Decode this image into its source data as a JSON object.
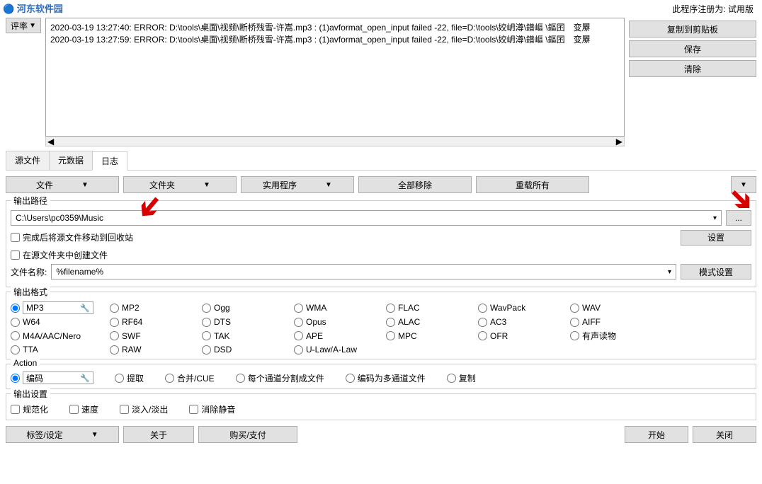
{
  "logo": {
    "text": "河东软件园"
  },
  "header": {
    "registration": "此程序注册为: 试用版"
  },
  "topleft": {
    "filter_label": "评率"
  },
  "log": {
    "content": "2020-03-19 13:27:40: ERROR: D:\\tools\\桌面\\视频\\断桥残雪-许嵩.mp3 : (1)avformat_open_input failed -22, file=D:\\tools\\姣岄澊\\鐠嶇   \\鏂囨　变屪\n2020-03-19 13:27:59: ERROR: D:\\tools\\桌面\\视频\\断桥残雪-许嵩.mp3 : (1)avformat_open_input failed -22, file=D:\\tools\\姣岄澊\\鐠嶇   \\鏂囨　变屪"
  },
  "sidebuttons": {
    "copy": "复制到剪贴板",
    "save": "保存",
    "clear": "清除"
  },
  "tabs": [
    "源文件",
    "元数据",
    "日志"
  ],
  "toolbar": {
    "file": "文件",
    "folder": "文件夹",
    "utilities": "实用程序",
    "remove_all": "全部移除",
    "reload_all": "重载所有"
  },
  "output_path": {
    "title": "输出路径",
    "value": "C:\\Users\\pc0359\\Music",
    "browse": "...",
    "move_recycle": "完成后将源文件移动到回收站",
    "settings": "设置",
    "create_in_source": "在源文件夹中创建文件",
    "filename_label": "文件名称:",
    "filename_value": "%filename%",
    "pattern_settings": "模式设置"
  },
  "output_format": {
    "title": "输出格式",
    "items": [
      "MP3",
      "MP2",
      "Ogg",
      "WMA",
      "FLAC",
      "WavPack",
      "WAV",
      "W64",
      "RF64",
      "DTS",
      "Opus",
      "ALAC",
      "AC3",
      "AIFF",
      "M4A/AAC/Nero",
      "SWF",
      "TAK",
      "APE",
      "MPC",
      "OFR",
      "有声读物",
      "TTA",
      "RAW",
      "DSD",
      "U-Law/A-Law"
    ]
  },
  "action": {
    "title": "Action",
    "items": [
      "编码",
      "提取",
      "合并/CUE",
      "每个通道分割成文件",
      "编码为多通道文件",
      "复制"
    ]
  },
  "output_settings": {
    "title": "输出设置",
    "items": [
      "规范化",
      "速度",
      "淡入/淡出",
      "消除静音"
    ]
  },
  "bottom": {
    "tag_settings": "标签/设定",
    "about": "关于",
    "purchase": "购买/支付",
    "start": "开始",
    "close": "关闭"
  }
}
